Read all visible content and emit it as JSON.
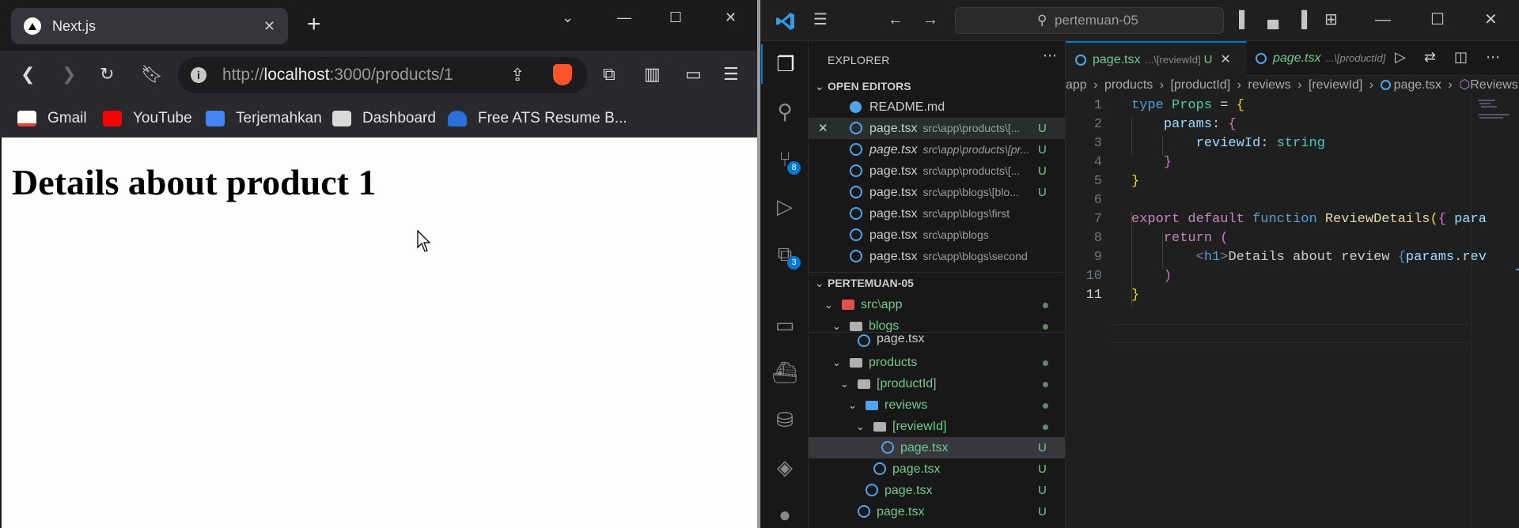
{
  "browser": {
    "tab_title": "Next.js",
    "url_prefix": "http://",
    "url_host": "localhost",
    "url_rest": ":3000/products/1",
    "bookmarks": [
      "Gmail",
      "YouTube",
      "Terjemahkan",
      "Dashboard",
      "Free ATS Resume B..."
    ],
    "page_heading": "Details about product 1"
  },
  "vscode": {
    "search_text": "pertemuan-05",
    "badges": {
      "source_control": "8",
      "extensions": "3"
    },
    "explorer_title": "EXPLORER",
    "open_editors_label": "OPEN EDITORS",
    "project_label": "PERTEMUAN-05",
    "open_editors": [
      {
        "name": "README.md",
        "path": "",
        "status": ""
      },
      {
        "name": "page.tsx",
        "path": "src\\app\\products\\[...",
        "status": "U"
      },
      {
        "name": "page.tsx",
        "path": "src\\app\\products\\[pr...",
        "status": "U"
      },
      {
        "name": "page.tsx",
        "path": "src\\app\\products\\[...",
        "status": "U"
      },
      {
        "name": "page.tsx",
        "path": "src\\app\\blogs\\[blo...",
        "status": "U"
      },
      {
        "name": "page.tsx",
        "path": "src\\app\\blogs\\first",
        "status": ""
      },
      {
        "name": "page.tsx",
        "path": "src\\app\\blogs",
        "status": ""
      },
      {
        "name": "page.tsx",
        "path": "src\\app\\blogs\\second",
        "status": ""
      }
    ],
    "tree": {
      "src": "src",
      "sep": "\\",
      "app": "app",
      "blogs": "blogs",
      "blogs_page": "page.tsx",
      "products": "products",
      "productId": "[productId]",
      "reviews": "reviews",
      "reviewId": "[reviewId]",
      "review_page": "page.tsx",
      "reviews_page": "page.tsx",
      "productId_page": "page.tsx",
      "products_page": "page.tsx",
      "status_u": "U"
    },
    "tabs": [
      {
        "name": "page.tsx",
        "hint": "...\\[reviewId]",
        "status": "U"
      },
      {
        "name": "page.tsx",
        "hint": "...\\[productId]",
        "status": ""
      }
    ],
    "breadcrumbs": [
      "app",
      "products",
      "[productId]",
      "reviews",
      "[reviewId]",
      "page.tsx",
      "Reviews"
    ],
    "line_numbers": [
      "1",
      "2",
      "3",
      "4",
      "5",
      "6",
      "7",
      "8",
      "9",
      "10",
      "11"
    ]
  }
}
